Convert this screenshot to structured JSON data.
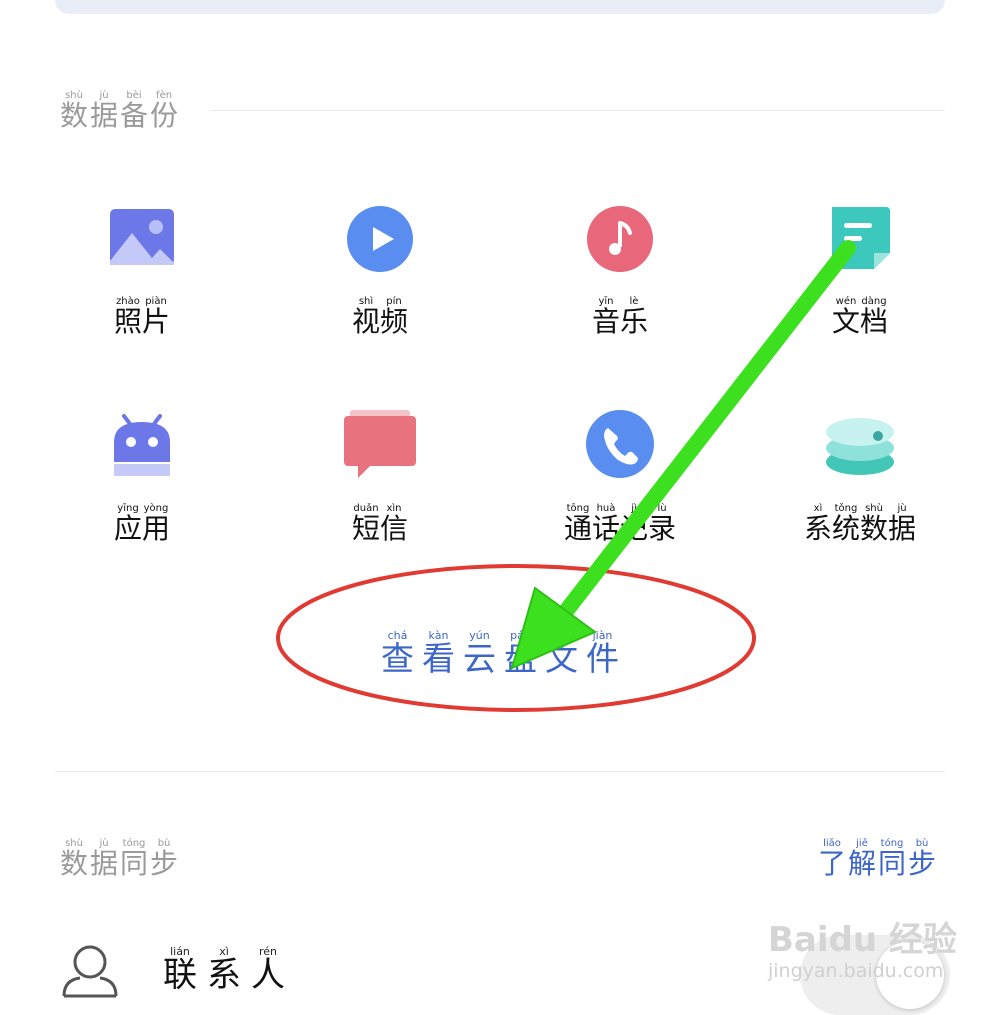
{
  "backup": {
    "title": [
      {
        "py": "shù",
        "hz": "数"
      },
      {
        "py": "jù",
        "hz": "据"
      },
      {
        "py": "bèi",
        "hz": "备"
      },
      {
        "py": "fèn",
        "hz": "份"
      }
    ],
    "items": [
      {
        "icon": "photo-icon",
        "label": [
          {
            "py": "zhào",
            "hz": "照"
          },
          {
            "py": "piàn",
            "hz": "片"
          }
        ]
      },
      {
        "icon": "video-play-icon",
        "label": [
          {
            "py": "shì",
            "hz": "视"
          },
          {
            "py": "pín",
            "hz": "频"
          }
        ]
      },
      {
        "icon": "music-note-icon",
        "label": [
          {
            "py": "yīn",
            "hz": "音"
          },
          {
            "py": "lè",
            "hz": "乐"
          }
        ]
      },
      {
        "icon": "document-icon",
        "label": [
          {
            "py": "wén",
            "hz": "文"
          },
          {
            "py": "dàng",
            "hz": "档"
          }
        ]
      },
      {
        "icon": "android-app-icon",
        "label": [
          {
            "py": "yīng",
            "hz": "应"
          },
          {
            "py": "yòng",
            "hz": "用"
          }
        ]
      },
      {
        "icon": "message-icon",
        "label": [
          {
            "py": "duǎn",
            "hz": "短"
          },
          {
            "py": "xìn",
            "hz": "信"
          }
        ]
      },
      {
        "icon": "phone-icon",
        "label": [
          {
            "py": "tōng",
            "hz": "通"
          },
          {
            "py": "huà",
            "hz": "话"
          },
          {
            "py": "jì",
            "hz": "记"
          },
          {
            "py": "lù",
            "hz": "录"
          }
        ]
      },
      {
        "icon": "system-data-icon",
        "label": [
          {
            "py": "xì",
            "hz": "系"
          },
          {
            "py": "tǒng",
            "hz": "统"
          },
          {
            "py": "shù",
            "hz": "数"
          },
          {
            "py": "jù",
            "hz": "据"
          }
        ]
      }
    ],
    "view_cloud": [
      {
        "py": "chá",
        "hz": "查"
      },
      {
        "py": "kàn",
        "hz": "看"
      },
      {
        "py": "yún",
        "hz": "云"
      },
      {
        "py": "pán",
        "hz": "盘"
      },
      {
        "py": "wén",
        "hz": "文"
      },
      {
        "py": "jiàn",
        "hz": "件"
      }
    ]
  },
  "sync": {
    "title": [
      {
        "py": "shù",
        "hz": "数"
      },
      {
        "py": "jù",
        "hz": "据"
      },
      {
        "py": "tóng",
        "hz": "同"
      },
      {
        "py": "bù",
        "hz": "步"
      }
    ],
    "learn": [
      {
        "py": "liǎo",
        "hz": "了"
      },
      {
        "py": "jiě",
        "hz": "解"
      },
      {
        "py": "tóng",
        "hz": "同"
      },
      {
        "py": "bù",
        "hz": "步"
      }
    ],
    "contact": [
      {
        "py": "lián",
        "hz": "联"
      },
      {
        "py": "xì",
        "hz": "系"
      },
      {
        "py": "rén",
        "hz": "人"
      }
    ]
  },
  "watermark": {
    "logo": "Baidu 经验",
    "url": "jingyan.baidu.com"
  },
  "colors": {
    "link_blue": "#3c66c8",
    "section_gray": "#9a9a9a",
    "circle_red": "#e03a32",
    "arrow_green": "#3de01f"
  }
}
